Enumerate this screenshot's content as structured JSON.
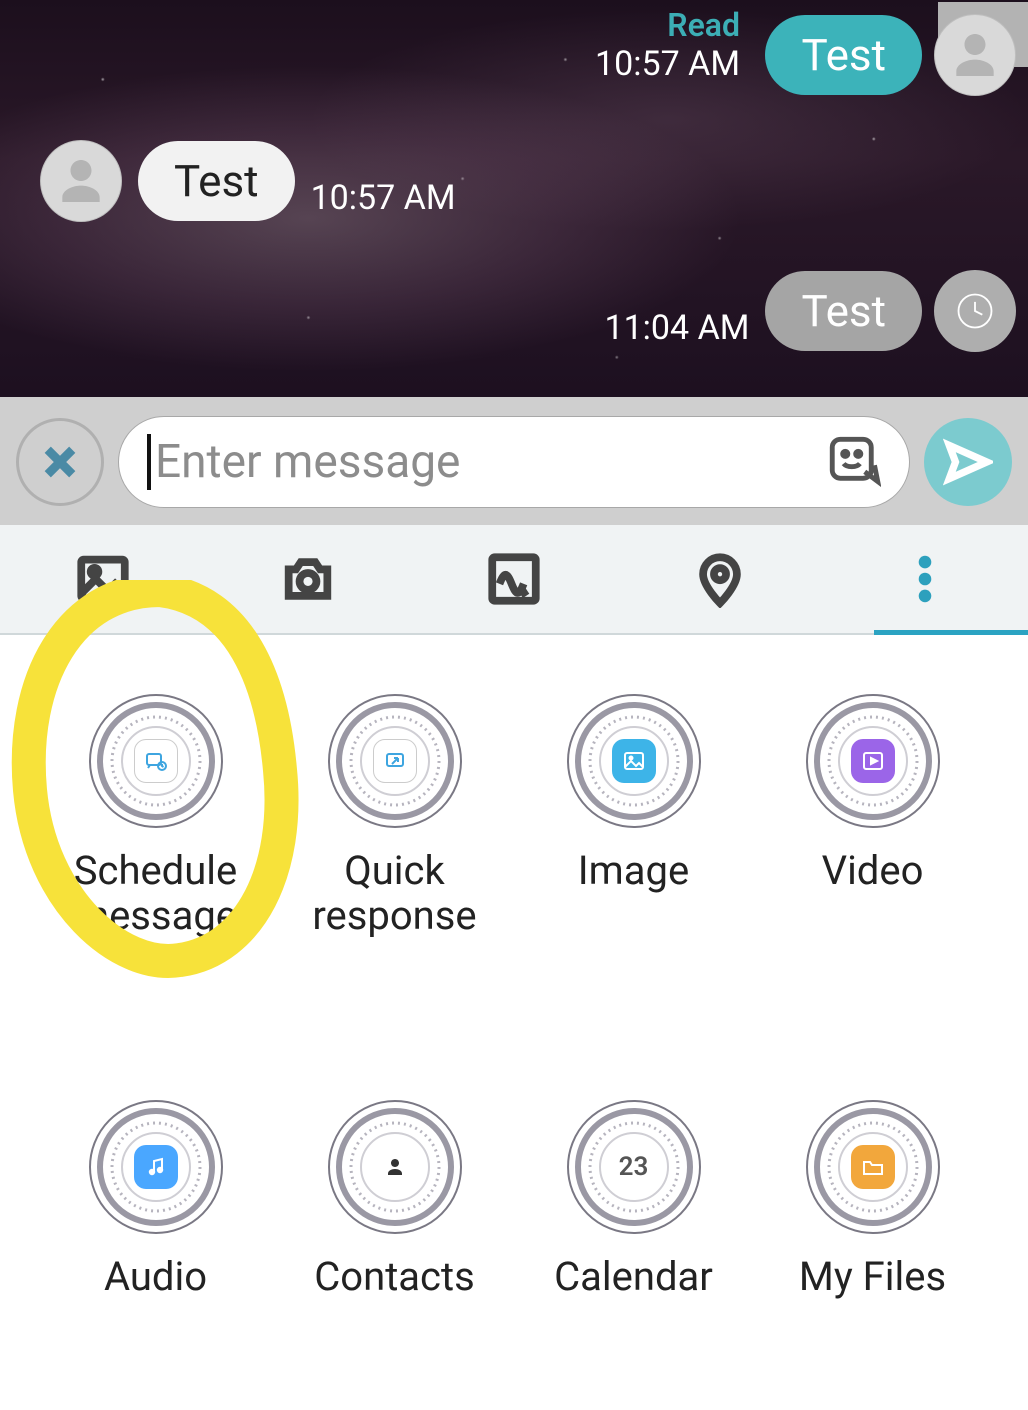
{
  "messages": {
    "out1": {
      "text": "Test",
      "time": "10:57 AM",
      "status": "Read"
    },
    "in1": {
      "text": "Test",
      "time": "10:57 AM"
    },
    "out2": {
      "text": "Test",
      "time": "11:04 AM"
    }
  },
  "input": {
    "placeholder": "Enter message"
  },
  "attachments": [
    {
      "label": "Schedule message"
    },
    {
      "label": "Quick response"
    },
    {
      "label": "Image"
    },
    {
      "label": "Video"
    },
    {
      "label": "Audio"
    },
    {
      "label": "Contacts"
    },
    {
      "label": "Calendar"
    },
    {
      "label": "My Files"
    }
  ],
  "calendar_day": "23"
}
